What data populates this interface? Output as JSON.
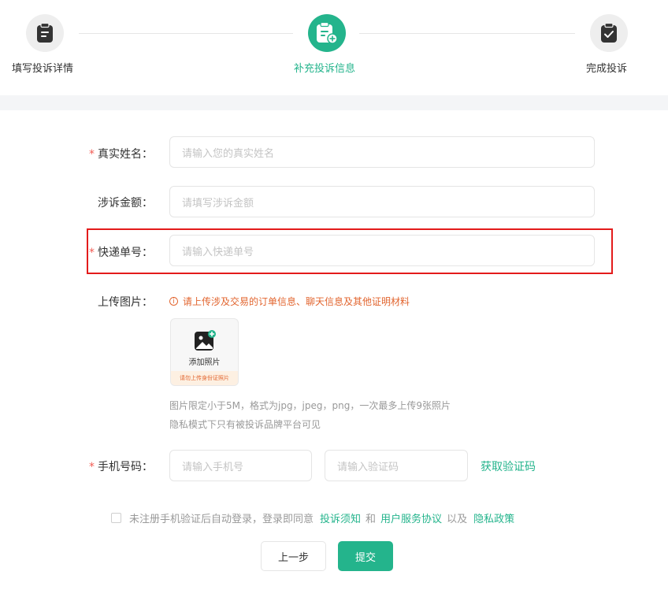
{
  "steps": [
    {
      "label": "填写投诉详情",
      "icon": "clipboard-list-icon",
      "state": "done"
    },
    {
      "label": "补充投诉信息",
      "icon": "clipboard-add-icon",
      "state": "active"
    },
    {
      "label": "完成投诉",
      "icon": "clipboard-check-icon",
      "state": "pending"
    }
  ],
  "form": {
    "real_name": {
      "label": "真实姓名：",
      "required": "*",
      "placeholder": "请输入您的真实姓名",
      "value": ""
    },
    "amount": {
      "label": "涉诉金额：",
      "placeholder": "请填写涉诉金额",
      "value": ""
    },
    "tracking": {
      "label": "快递单号：",
      "required": "*",
      "placeholder": "请输入快递单号",
      "value": ""
    },
    "upload": {
      "label": "上传图片：",
      "hint_icon": "ⓘ",
      "hint": "请上传涉及交易的订单信息、聊天信息及其他证明材料",
      "button_text": "添加照片",
      "button_tip": "请勿上传身份证照片",
      "note1": "图片限定小于5M，格式为jpg，jpeg，png，一次最多上传9张照片",
      "note2": "隐私模式下只有被投诉品牌平台可见"
    },
    "phone": {
      "label": "手机号码：",
      "required": "*",
      "placeholder": "请输入手机号",
      "code_placeholder": "请输入验证码",
      "get_code": "获取验证码"
    }
  },
  "agreement": {
    "text1": "未注册手机验证后自动登录，登录即同意",
    "link1": "投诉须知",
    "and": "和",
    "link2": "用户服务协议",
    "text2": "以及",
    "link3": "隐私政策",
    "checked": false
  },
  "buttons": {
    "prev": "上一步",
    "submit": "提交"
  },
  "colors": {
    "accent": "#24b48c",
    "required": "#f25c54",
    "hint": "#e2652f",
    "highlight": "#e31b1b"
  }
}
